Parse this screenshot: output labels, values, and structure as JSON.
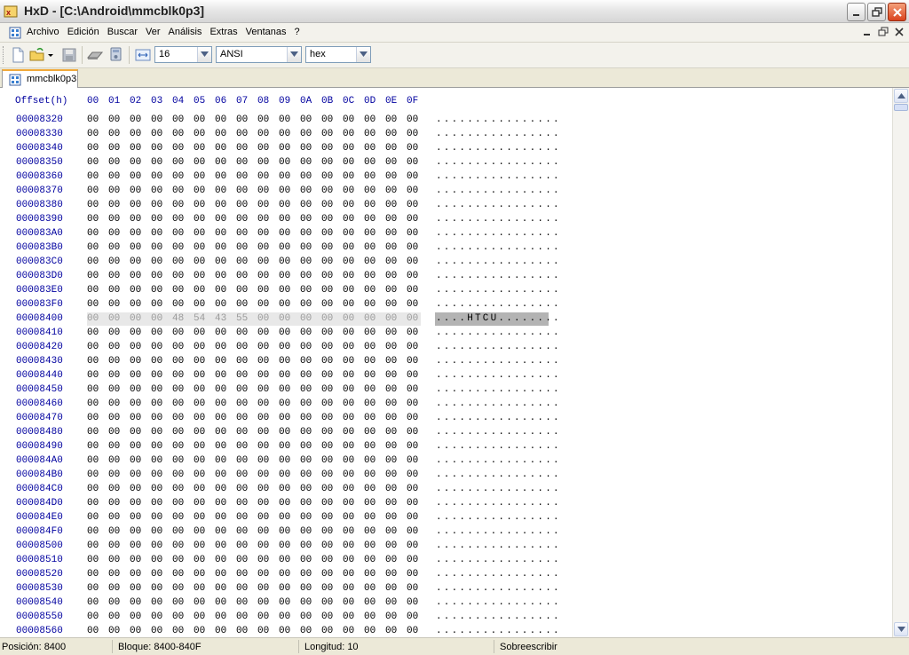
{
  "window": {
    "title": "HxD - [C:\\Android\\mmcblk0p3]"
  },
  "menu": {
    "items": [
      "Archivo",
      "Edición",
      "Buscar",
      "Ver",
      "Análisis",
      "Extras",
      "Ventanas",
      "?"
    ]
  },
  "toolbar": {
    "bytes_per_row": "16",
    "charset": "ANSI",
    "offset_base": "hex"
  },
  "tab": {
    "label": "mmcblk0p3"
  },
  "hex_view": {
    "header_offset": "Offset(h)",
    "columns": [
      "00",
      "01",
      "02",
      "03",
      "04",
      "05",
      "06",
      "07",
      "08",
      "09",
      "0A",
      "0B",
      "0C",
      "0D",
      "0E",
      "0F"
    ],
    "selected_row_index": 14,
    "rows": [
      {
        "offset": "00008320",
        "bytes": [
          "00",
          "00",
          "00",
          "00",
          "00",
          "00",
          "00",
          "00",
          "00",
          "00",
          "00",
          "00",
          "00",
          "00",
          "00",
          "00"
        ],
        "ascii": "................"
      },
      {
        "offset": "00008330",
        "bytes": [
          "00",
          "00",
          "00",
          "00",
          "00",
          "00",
          "00",
          "00",
          "00",
          "00",
          "00",
          "00",
          "00",
          "00",
          "00",
          "00"
        ],
        "ascii": "................"
      },
      {
        "offset": "00008340",
        "bytes": [
          "00",
          "00",
          "00",
          "00",
          "00",
          "00",
          "00",
          "00",
          "00",
          "00",
          "00",
          "00",
          "00",
          "00",
          "00",
          "00"
        ],
        "ascii": "................"
      },
      {
        "offset": "00008350",
        "bytes": [
          "00",
          "00",
          "00",
          "00",
          "00",
          "00",
          "00",
          "00",
          "00",
          "00",
          "00",
          "00",
          "00",
          "00",
          "00",
          "00"
        ],
        "ascii": "................"
      },
      {
        "offset": "00008360",
        "bytes": [
          "00",
          "00",
          "00",
          "00",
          "00",
          "00",
          "00",
          "00",
          "00",
          "00",
          "00",
          "00",
          "00",
          "00",
          "00",
          "00"
        ],
        "ascii": "................"
      },
      {
        "offset": "00008370",
        "bytes": [
          "00",
          "00",
          "00",
          "00",
          "00",
          "00",
          "00",
          "00",
          "00",
          "00",
          "00",
          "00",
          "00",
          "00",
          "00",
          "00"
        ],
        "ascii": "................"
      },
      {
        "offset": "00008380",
        "bytes": [
          "00",
          "00",
          "00",
          "00",
          "00",
          "00",
          "00",
          "00",
          "00",
          "00",
          "00",
          "00",
          "00",
          "00",
          "00",
          "00"
        ],
        "ascii": "................"
      },
      {
        "offset": "00008390",
        "bytes": [
          "00",
          "00",
          "00",
          "00",
          "00",
          "00",
          "00",
          "00",
          "00",
          "00",
          "00",
          "00",
          "00",
          "00",
          "00",
          "00"
        ],
        "ascii": "................"
      },
      {
        "offset": "000083A0",
        "bytes": [
          "00",
          "00",
          "00",
          "00",
          "00",
          "00",
          "00",
          "00",
          "00",
          "00",
          "00",
          "00",
          "00",
          "00",
          "00",
          "00"
        ],
        "ascii": "................"
      },
      {
        "offset": "000083B0",
        "bytes": [
          "00",
          "00",
          "00",
          "00",
          "00",
          "00",
          "00",
          "00",
          "00",
          "00",
          "00",
          "00",
          "00",
          "00",
          "00",
          "00"
        ],
        "ascii": "................"
      },
      {
        "offset": "000083C0",
        "bytes": [
          "00",
          "00",
          "00",
          "00",
          "00",
          "00",
          "00",
          "00",
          "00",
          "00",
          "00",
          "00",
          "00",
          "00",
          "00",
          "00"
        ],
        "ascii": "................"
      },
      {
        "offset": "000083D0",
        "bytes": [
          "00",
          "00",
          "00",
          "00",
          "00",
          "00",
          "00",
          "00",
          "00",
          "00",
          "00",
          "00",
          "00",
          "00",
          "00",
          "00"
        ],
        "ascii": "................"
      },
      {
        "offset": "000083E0",
        "bytes": [
          "00",
          "00",
          "00",
          "00",
          "00",
          "00",
          "00",
          "00",
          "00",
          "00",
          "00",
          "00",
          "00",
          "00",
          "00",
          "00"
        ],
        "ascii": "................"
      },
      {
        "offset": "000083F0",
        "bytes": [
          "00",
          "00",
          "00",
          "00",
          "00",
          "00",
          "00",
          "00",
          "00",
          "00",
          "00",
          "00",
          "00",
          "00",
          "00",
          "00"
        ],
        "ascii": "................"
      },
      {
        "offset": "00008400",
        "bytes": [
          "00",
          "00",
          "00",
          "00",
          "48",
          "54",
          "43",
          "55",
          "00",
          "00",
          "00",
          "00",
          "00",
          "00",
          "00",
          "00"
        ],
        "ascii": "....HTCU........"
      },
      {
        "offset": "00008410",
        "bytes": [
          "00",
          "00",
          "00",
          "00",
          "00",
          "00",
          "00",
          "00",
          "00",
          "00",
          "00",
          "00",
          "00",
          "00",
          "00",
          "00"
        ],
        "ascii": "................"
      },
      {
        "offset": "00008420",
        "bytes": [
          "00",
          "00",
          "00",
          "00",
          "00",
          "00",
          "00",
          "00",
          "00",
          "00",
          "00",
          "00",
          "00",
          "00",
          "00",
          "00"
        ],
        "ascii": "................"
      },
      {
        "offset": "00008430",
        "bytes": [
          "00",
          "00",
          "00",
          "00",
          "00",
          "00",
          "00",
          "00",
          "00",
          "00",
          "00",
          "00",
          "00",
          "00",
          "00",
          "00"
        ],
        "ascii": "................"
      },
      {
        "offset": "00008440",
        "bytes": [
          "00",
          "00",
          "00",
          "00",
          "00",
          "00",
          "00",
          "00",
          "00",
          "00",
          "00",
          "00",
          "00",
          "00",
          "00",
          "00"
        ],
        "ascii": "................"
      },
      {
        "offset": "00008450",
        "bytes": [
          "00",
          "00",
          "00",
          "00",
          "00",
          "00",
          "00",
          "00",
          "00",
          "00",
          "00",
          "00",
          "00",
          "00",
          "00",
          "00"
        ],
        "ascii": "................"
      },
      {
        "offset": "00008460",
        "bytes": [
          "00",
          "00",
          "00",
          "00",
          "00",
          "00",
          "00",
          "00",
          "00",
          "00",
          "00",
          "00",
          "00",
          "00",
          "00",
          "00"
        ],
        "ascii": "................"
      },
      {
        "offset": "00008470",
        "bytes": [
          "00",
          "00",
          "00",
          "00",
          "00",
          "00",
          "00",
          "00",
          "00",
          "00",
          "00",
          "00",
          "00",
          "00",
          "00",
          "00"
        ],
        "ascii": "................"
      },
      {
        "offset": "00008480",
        "bytes": [
          "00",
          "00",
          "00",
          "00",
          "00",
          "00",
          "00",
          "00",
          "00",
          "00",
          "00",
          "00",
          "00",
          "00",
          "00",
          "00"
        ],
        "ascii": "................"
      },
      {
        "offset": "00008490",
        "bytes": [
          "00",
          "00",
          "00",
          "00",
          "00",
          "00",
          "00",
          "00",
          "00",
          "00",
          "00",
          "00",
          "00",
          "00",
          "00",
          "00"
        ],
        "ascii": "................"
      },
      {
        "offset": "000084A0",
        "bytes": [
          "00",
          "00",
          "00",
          "00",
          "00",
          "00",
          "00",
          "00",
          "00",
          "00",
          "00",
          "00",
          "00",
          "00",
          "00",
          "00"
        ],
        "ascii": "................"
      },
      {
        "offset": "000084B0",
        "bytes": [
          "00",
          "00",
          "00",
          "00",
          "00",
          "00",
          "00",
          "00",
          "00",
          "00",
          "00",
          "00",
          "00",
          "00",
          "00",
          "00"
        ],
        "ascii": "................"
      },
      {
        "offset": "000084C0",
        "bytes": [
          "00",
          "00",
          "00",
          "00",
          "00",
          "00",
          "00",
          "00",
          "00",
          "00",
          "00",
          "00",
          "00",
          "00",
          "00",
          "00"
        ],
        "ascii": "................"
      },
      {
        "offset": "000084D0",
        "bytes": [
          "00",
          "00",
          "00",
          "00",
          "00",
          "00",
          "00",
          "00",
          "00",
          "00",
          "00",
          "00",
          "00",
          "00",
          "00",
          "00"
        ],
        "ascii": "................"
      },
      {
        "offset": "000084E0",
        "bytes": [
          "00",
          "00",
          "00",
          "00",
          "00",
          "00",
          "00",
          "00",
          "00",
          "00",
          "00",
          "00",
          "00",
          "00",
          "00",
          "00"
        ],
        "ascii": "................"
      },
      {
        "offset": "000084F0",
        "bytes": [
          "00",
          "00",
          "00",
          "00",
          "00",
          "00",
          "00",
          "00",
          "00",
          "00",
          "00",
          "00",
          "00",
          "00",
          "00",
          "00"
        ],
        "ascii": "................"
      },
      {
        "offset": "00008500",
        "bytes": [
          "00",
          "00",
          "00",
          "00",
          "00",
          "00",
          "00",
          "00",
          "00",
          "00",
          "00",
          "00",
          "00",
          "00",
          "00",
          "00"
        ],
        "ascii": "................"
      },
      {
        "offset": "00008510",
        "bytes": [
          "00",
          "00",
          "00",
          "00",
          "00",
          "00",
          "00",
          "00",
          "00",
          "00",
          "00",
          "00",
          "00",
          "00",
          "00",
          "00"
        ],
        "ascii": "................"
      },
      {
        "offset": "00008520",
        "bytes": [
          "00",
          "00",
          "00",
          "00",
          "00",
          "00",
          "00",
          "00",
          "00",
          "00",
          "00",
          "00",
          "00",
          "00",
          "00",
          "00"
        ],
        "ascii": "................"
      },
      {
        "offset": "00008530",
        "bytes": [
          "00",
          "00",
          "00",
          "00",
          "00",
          "00",
          "00",
          "00",
          "00",
          "00",
          "00",
          "00",
          "00",
          "00",
          "00",
          "00"
        ],
        "ascii": "................"
      },
      {
        "offset": "00008540",
        "bytes": [
          "00",
          "00",
          "00",
          "00",
          "00",
          "00",
          "00",
          "00",
          "00",
          "00",
          "00",
          "00",
          "00",
          "00",
          "00",
          "00"
        ],
        "ascii": "................"
      },
      {
        "offset": "00008550",
        "bytes": [
          "00",
          "00",
          "00",
          "00",
          "00",
          "00",
          "00",
          "00",
          "00",
          "00",
          "00",
          "00",
          "00",
          "00",
          "00",
          "00"
        ],
        "ascii": "................"
      },
      {
        "offset": "00008560",
        "bytes": [
          "00",
          "00",
          "00",
          "00",
          "00",
          "00",
          "00",
          "00",
          "00",
          "00",
          "00",
          "00",
          "00",
          "00",
          "00",
          "00"
        ],
        "ascii": "................"
      }
    ]
  },
  "status": {
    "position": "Posición: 8400",
    "block": "Bloque: 8400-840F",
    "length": "Longitud: 10",
    "mode": "Sobreescribir"
  }
}
